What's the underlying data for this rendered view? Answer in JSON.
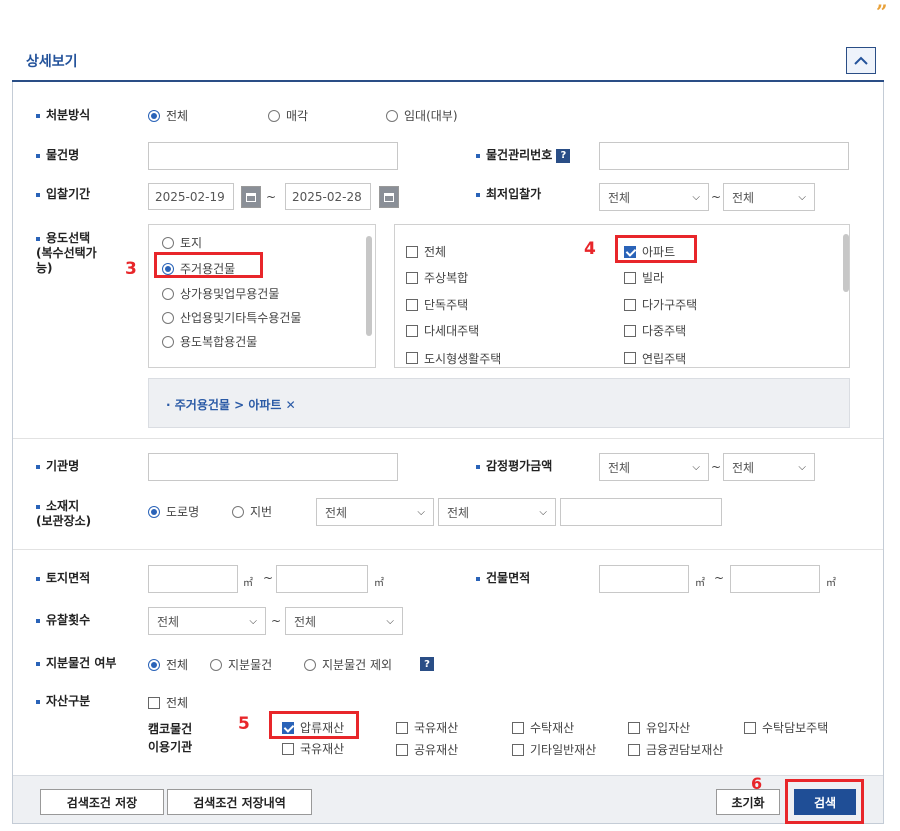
{
  "header": {
    "title": "상세보기"
  },
  "disposal": {
    "label": "처분방식",
    "options": [
      "전체",
      "매각",
      "임대(대부)"
    ]
  },
  "item_name": {
    "label": "물건명",
    "value": ""
  },
  "item_no": {
    "label": "물건관리번호"
  },
  "bid_period": {
    "label": "입찰기간",
    "start": "2025-02-19",
    "end": "2025-02-28",
    "sep": "~"
  },
  "min_bid": {
    "label": "최저입찰가",
    "from": "전체",
    "to": "전체"
  },
  "usage": {
    "label_lines": [
      "용도선택",
      "(복수선택가",
      "능)"
    ],
    "left_options": [
      "토지",
      "주거용건물",
      "상가용및업무용건물",
      "산업용및기타특수용건물",
      "용도복합용건물"
    ],
    "right_col1": [
      "전체",
      "주상복합",
      "단독주택",
      "다세대주택",
      "도시형생활주택"
    ],
    "right_col2": [
      "아파트",
      "빌라",
      "다가구주택",
      "다중주택",
      "연립주택"
    ],
    "selected_tag": "· 주거용건물 > 아파트 ✕"
  },
  "agency": {
    "label": "기관명"
  },
  "appraisal": {
    "label": "감정평가금액",
    "from": "전체",
    "to": "전체"
  },
  "location": {
    "label_lines": [
      "소재지",
      "(보관장소)"
    ],
    "options": [
      "도로명",
      "지번"
    ],
    "sel1": "전체",
    "sel2": "전체"
  },
  "land_area": {
    "label": "토지면적",
    "unit": "㎡",
    "sep": "~"
  },
  "building_area": {
    "label": "건물면적",
    "unit": "㎡",
    "sep": "~"
  },
  "failed_count": {
    "label": "유찰횟수",
    "from": "전체",
    "to": "전체"
  },
  "share": {
    "label": "지분물건 여부",
    "options": [
      "전체",
      "지분물건",
      "지분물건 제외"
    ]
  },
  "asset": {
    "label": "자산구분",
    "all": "전체",
    "row1_label": "캠코물건",
    "row1": [
      "압류재산",
      "국유재산",
      "수탁재산",
      "유입자산",
      "수탁담보주택"
    ],
    "row2_label": "이용기관",
    "row2": [
      "국유재산",
      "공유재산",
      "기타일반재산",
      "금융권담보재산"
    ]
  },
  "footer": {
    "save": "검색조건 저장",
    "history": "검색조건 저장내역",
    "reset": "초기화",
    "search": "검색"
  },
  "annotations": {
    "n3": "3",
    "n4": "4",
    "n5": "5",
    "n6": "6"
  },
  "help_glyph": "?",
  "quote_glyph": "”",
  "colors": {
    "accent": "#2a4e86",
    "annotation": "#e8262a"
  }
}
